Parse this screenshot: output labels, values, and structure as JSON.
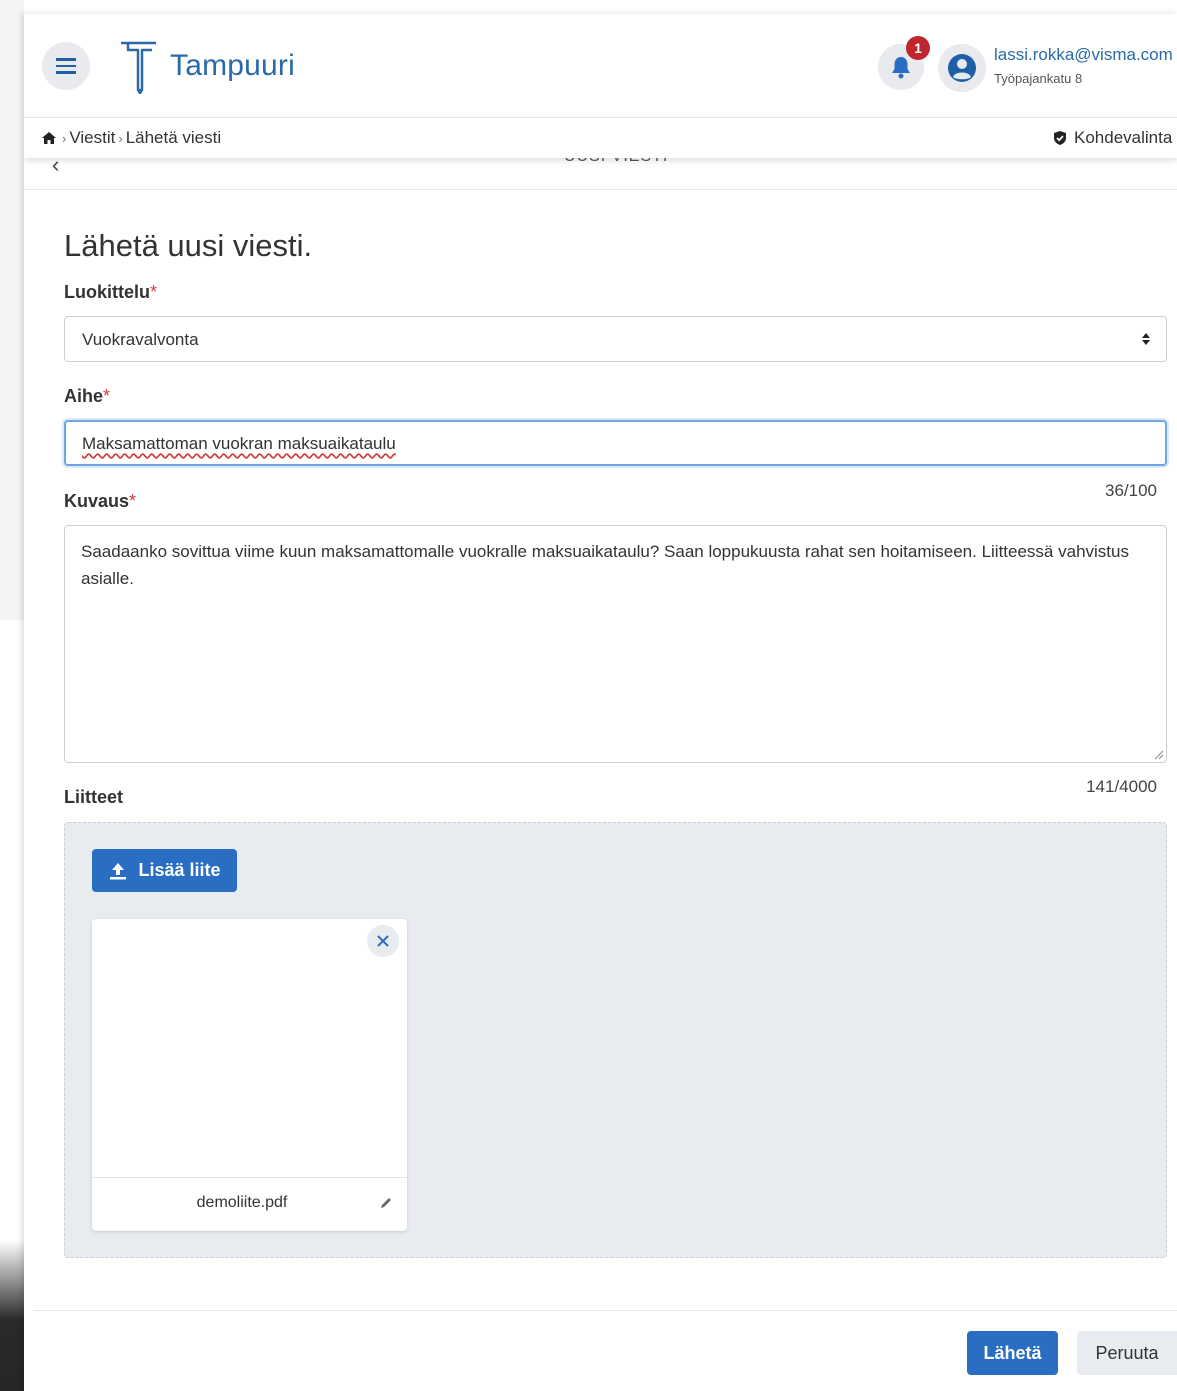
{
  "header": {
    "app_name": "Tampuuri",
    "notification_count": "1",
    "user_email": "lassi.rokka@visma.com",
    "user_address": "Työpajankatu 8"
  },
  "breadcrumb": {
    "items": [
      "Viestit",
      "Lähetä viesti"
    ],
    "target_label": "Kohdevalinta"
  },
  "subheader": {
    "title": "UUSI VIESTI"
  },
  "form": {
    "title": "Lähetä uusi viesti.",
    "category": {
      "label": "Luokittelu",
      "required_mark": "*",
      "value": "Vuokravalvonta"
    },
    "subject": {
      "label": "Aihe",
      "required_mark": "*",
      "value": "Maksamattoman vuokran maksuaikataulu",
      "counter": "36/100"
    },
    "description": {
      "label": "Kuvaus",
      "required_mark": "*",
      "value": "Saadaanko sovittua viime kuun maksamattomalle vuokralle maksuaikataulu? Saan loppukuusta rahat sen hoitamiseen. Liitteessä vahvistus asialle.",
      "counter": "141/4000"
    },
    "attachments": {
      "label": "Liitteet",
      "add_button": "Lisää liite",
      "files": [
        {
          "name": "demoliite.pdf"
        }
      ]
    }
  },
  "actions": {
    "send": "Lähetä",
    "cancel": "Peruuta"
  },
  "colors": {
    "primary": "#2a6ec4",
    "brand_text": "#2a6aa8",
    "required": "#d23b3b",
    "badge": "#c0262d",
    "attachment_bg": "#e8ebef"
  },
  "icons": [
    "menu-icon",
    "tampuuri-logo",
    "bell-icon",
    "user-icon",
    "home-icon",
    "shield-check-icon",
    "chevron-left-icon",
    "sort-arrows-icon",
    "upload-icon",
    "close-icon",
    "pencil-icon",
    "resize-grip-icon"
  ]
}
